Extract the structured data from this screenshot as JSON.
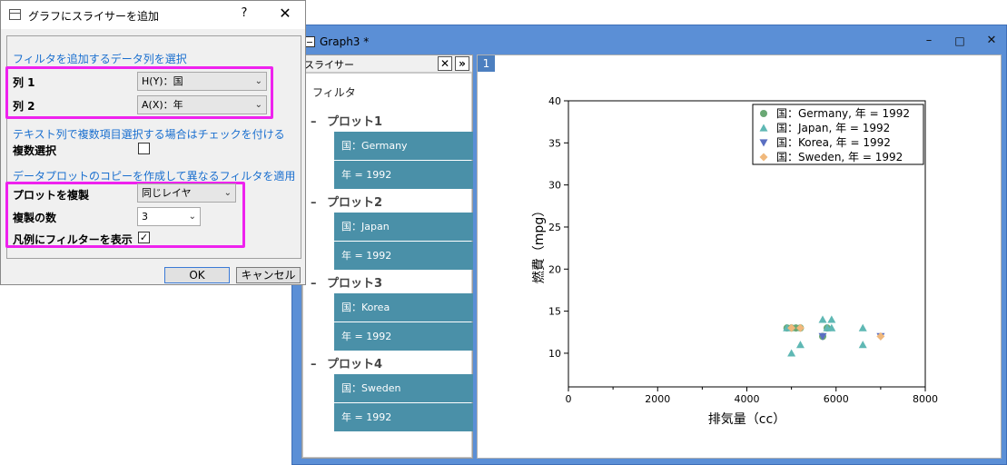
{
  "graph_window": {
    "title": "Graph3 *",
    "controls": {
      "minimize": "–",
      "maximize": "□",
      "close": "✕"
    },
    "page_tab": "1",
    "slicer": {
      "header": "スライサー",
      "close_glyph": "✕",
      "expand_glyph": "»",
      "filter_label": "フィルタ",
      "plots": [
        {
          "name": "プロット1",
          "chips": [
            "国：Germany",
            "年 = 1992"
          ]
        },
        {
          "name": "プロット2",
          "chips": [
            "国：Japan",
            "年 = 1992"
          ]
        },
        {
          "name": "プロット3",
          "chips": [
            "国：Korea",
            "年 = 1992"
          ]
        },
        {
          "name": "プロット4",
          "chips": [
            "国：Sweden",
            "年 = 1992"
          ]
        }
      ]
    }
  },
  "chart_data": {
    "type": "scatter",
    "xlabel": "排気量（cc）",
    "ylabel": "燃費（mpg）",
    "xlim": [
      0,
      8000
    ],
    "ylim": [
      6,
      40
    ],
    "xticks": [
      0,
      2000,
      4000,
      6000,
      8000
    ],
    "yticks": [
      10,
      15,
      20,
      25,
      30,
      35,
      40
    ],
    "grid": false,
    "legend_position": "top-right",
    "series": [
      {
        "name": "国：Germany, 年 = 1992",
        "marker": "circle",
        "color": "#6aa874",
        "points": [
          [
            4900,
            13
          ],
          [
            5000,
            13
          ],
          [
            5100,
            13
          ],
          [
            5200,
            13
          ],
          [
            5700,
            12
          ],
          [
            5800,
            13
          ]
        ]
      },
      {
        "name": "国：Japan, 年 = 1992",
        "marker": "triangle-up",
        "color": "#5fb8b4",
        "points": [
          [
            4900,
            13
          ],
          [
            5000,
            10
          ],
          [
            5200,
            11
          ],
          [
            5700,
            14
          ],
          [
            5800,
            13
          ],
          [
            5900,
            14
          ],
          [
            5900,
            13
          ],
          [
            6600,
            13
          ],
          [
            6600,
            11
          ]
        ]
      },
      {
        "name": "国：Korea, 年 = 1992",
        "marker": "triangle-down",
        "color": "#5a6fc2",
        "points": [
          [
            5700,
            12
          ],
          [
            7000,
            12
          ]
        ]
      },
      {
        "name": "国：Sweden, 年 = 1992",
        "marker": "diamond",
        "color": "#f0b87c",
        "points": [
          [
            5000,
            13
          ],
          [
            5200,
            13
          ],
          [
            7000,
            12
          ]
        ]
      }
    ]
  },
  "dialog": {
    "title": "グラフにスライサーを追加",
    "help": "?",
    "close": "✕",
    "section1": "フィルタを追加するデータ列を選択",
    "col1_label": "列 1",
    "col1_value": "H(Y)：国",
    "col2_label": "列 2",
    "col2_value": "A(X)：年",
    "section2": "テキスト列で複数項目選択する場合はチェックを付ける",
    "multi_label": "複数選択",
    "multi_checked": false,
    "section3": "データプロットのコピーを作成して異なるフィルタを適用",
    "dup_label": "プロットを複製",
    "dup_value": "同じレイヤ",
    "count_label": "複製の数",
    "count_value": "3",
    "legend_label": "凡例にフィルターを表示",
    "legend_checked": true,
    "check_glyph": "✓",
    "caret_glyph": "⌄",
    "ok": "OK",
    "cancel": "キャンセル"
  }
}
